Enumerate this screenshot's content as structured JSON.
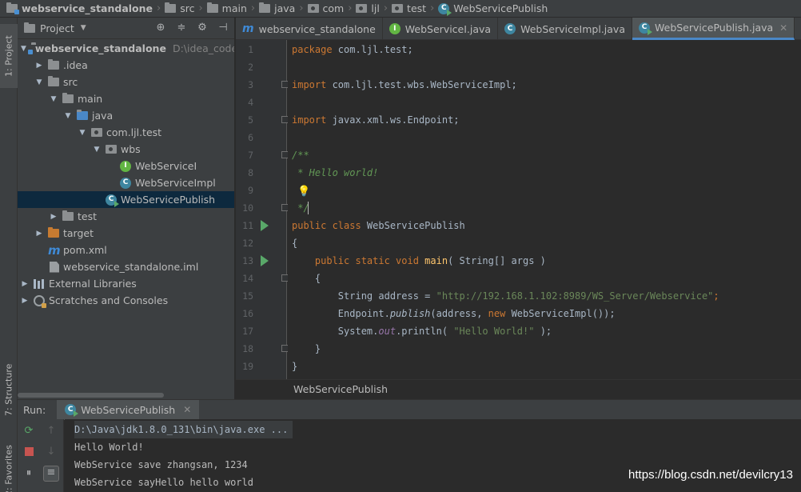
{
  "breadcrumb": [
    "webservice_standalone",
    "src",
    "main",
    "java",
    "com",
    "ljl",
    "test",
    "WebServicePublish"
  ],
  "left_strip": {
    "project": "1: Project",
    "structure": "7: Structure",
    "favorites": "2: Favorites"
  },
  "project_panel": {
    "title": "Project",
    "tree": [
      {
        "label": "webservice_standalone",
        "path": "D:\\idea_code\\w"
      },
      {
        "label": ".idea"
      },
      {
        "label": "src"
      },
      {
        "label": "main"
      },
      {
        "label": "java"
      },
      {
        "label": "com.ljl.test"
      },
      {
        "label": "wbs"
      },
      {
        "label": "WebServiceI"
      },
      {
        "label": "WebServiceImpl"
      },
      {
        "label": "WebServicePublish"
      },
      {
        "label": "test"
      },
      {
        "label": "target"
      },
      {
        "label": "pom.xml"
      },
      {
        "label": "webservice_standalone.iml"
      },
      {
        "label": "External Libraries"
      },
      {
        "label": "Scratches and Consoles"
      }
    ]
  },
  "tabs": [
    "webservice_standalone",
    "WebServiceI.java",
    "WebServiceImpl.java",
    "WebServicePublish.java"
  ],
  "editor": {
    "line_numbers": [
      "1",
      "2",
      "3",
      "4",
      "5",
      "6",
      "7",
      "8",
      "9",
      "10",
      "11",
      "12",
      "13",
      "14",
      "15",
      "16",
      "17",
      "18",
      "19"
    ],
    "code": {
      "l1a": "package ",
      "l1b": "com.ljl.test;",
      "l3a": "import ",
      "l3b": "com.ljl.test.wbs.WebServiceImpl;",
      "l5a": "import ",
      "l5b": "javax.xml.ws.Endpoint;",
      "l7": "/**",
      "l8": " * Hello world!",
      "l10": " */",
      "l11a": "public class ",
      "l11b": "WebServicePublish",
      "l12": "{",
      "l13a": "    public static void ",
      "l13b": "main",
      "l13c": "( String[] args )",
      "l14": "    {",
      "l15a": "        String address = ",
      "l15b": "\"http://192.168.1.102:8989/WS_Server/Webservice\"",
      "l15c": ";",
      "l16a": "        Endpoint.",
      "l16b": "publish",
      "l16c": "(address, ",
      "l16d": "new ",
      "l16e": "WebServiceImpl());",
      "l17a": "        System.",
      "l17b": "out",
      "l17c": ".println( ",
      "l17d": "\"Hello World!\"",
      "l17e": " );",
      "l18": "    }",
      "l19": "}"
    },
    "breadcrumb": "WebServicePublish"
  },
  "run": {
    "label": "Run:",
    "tab": "WebServicePublish",
    "console": [
      "D:\\Java\\jdk1.8.0_131\\bin\\java.exe ...",
      "Hello World!",
      "WebService save zhangsan, 1234",
      "WebService sayHello hello world"
    ]
  },
  "watermark": "https://blog.csdn.net/devilcry13",
  "icons": {
    "settings": "gear-icon",
    "target": "crosshair-icon",
    "collapse": "collapse-icon",
    "hide": "minimize-icon"
  },
  "colors": {
    "accent": "#4a88c7",
    "selection": "#0d293e",
    "keyword": "#cc7832",
    "string": "#6a8759",
    "comment": "#629755"
  }
}
